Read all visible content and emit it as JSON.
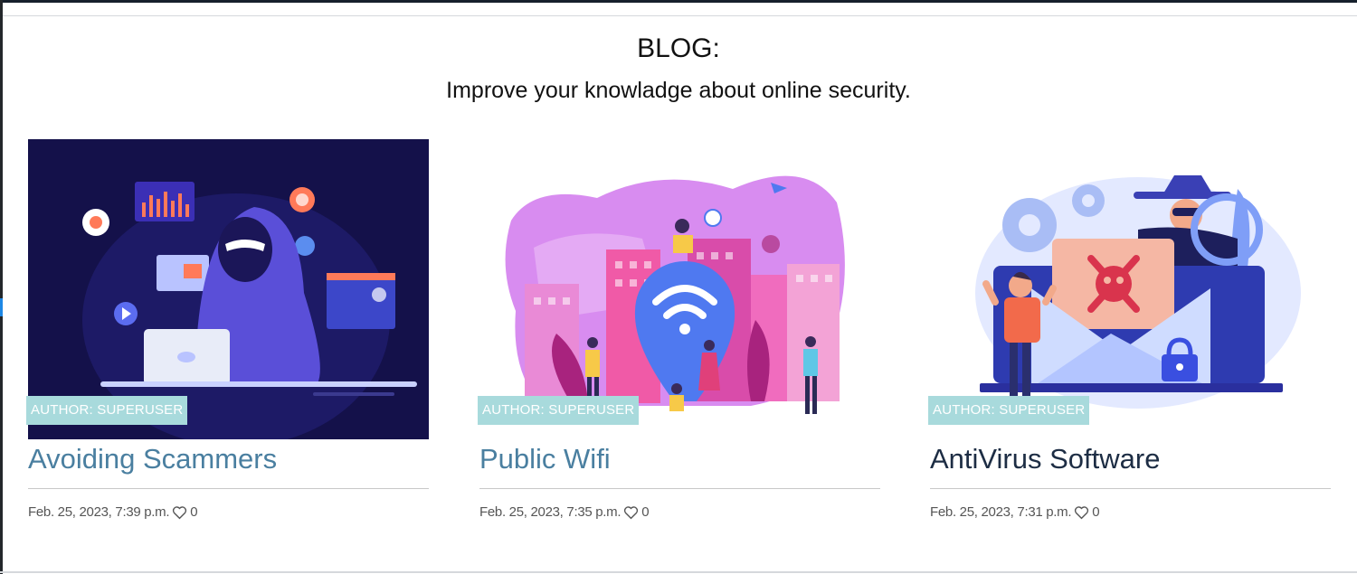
{
  "header": {
    "title": "BLOG:",
    "subtitle": "Improve your knowladge about online security."
  },
  "colors": {
    "badge_bg": "#a8dadc",
    "title_link": "#4a7fa0",
    "title_dark": "#1d2d44"
  },
  "posts": [
    {
      "badge": "AUTHOR: SUPERUSER",
      "title": "Avoiding Scammers",
      "date": "Feb. 25, 2023, 7:39 p.m.",
      "likes": "0",
      "image_icon": "hacker-illustration-icon"
    },
    {
      "badge": "AUTHOR: SUPERUSER",
      "title": "Public Wifi",
      "date": "Feb. 25, 2023, 7:35 p.m.",
      "likes": "0",
      "image_icon": "wifi-city-illustration-icon"
    },
    {
      "badge": "AUTHOR: SUPERUSER",
      "title": "AntiVirus Software",
      "date": "Feb. 25, 2023, 7:31 p.m.",
      "likes": "0",
      "image_icon": "virus-email-illustration-icon"
    }
  ]
}
